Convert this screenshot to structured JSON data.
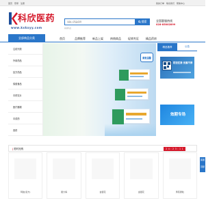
{
  "topbar": {
    "links": [
      "首页",
      "登录",
      "注册"
    ],
    "right_links": [
      "我的订单",
      "联系我们",
      "帮助中心"
    ]
  },
  "logo": {
    "mark": "K",
    "name": "科欣医药",
    "site": "www.kxkxyy.com"
  },
  "search": {
    "placeholder": "请输入药品名称",
    "button": "搜索",
    "hot": "热搜药品"
  },
  "hotline": {
    "label": "全国客服热线",
    "number": "028-85002899"
  },
  "nav": {
    "category": "全部商品分类",
    "items": [
      "首页",
      "品牌推荐",
      "新品上架",
      "热销商品",
      "促销专区",
      "精品药房"
    ]
  },
  "sidebar": {
    "items": [
      "注射剂类",
      "外用药品",
      "处方药品",
      "保健食品",
      "中药饮片",
      "医疗器械",
      "中成药",
      "西药"
    ]
  },
  "banner": {
    "badge": "康复温馨"
  },
  "right_panel": {
    "tab_active": "精品推荐",
    "tab_inactive": "公告",
    "ad1_text": "防控在我 优惠不停",
    "ad2_text": "效期专场"
  },
  "section": {
    "title": "限时抢购",
    "title_prefix": "|",
    "timer": "2 4 : 2 3 : 1 1"
  },
  "products": [
    {
      "name": "阿胶(复方)"
    },
    {
      "name": "胆大梅"
    },
    {
      "name": "金银花"
    },
    {
      "name": "金银花"
    },
    {
      "name": "黄芪颗粒"
    }
  ],
  "float_bar": {
    "items": [
      "客服",
      "顶部"
    ]
  },
  "colors": {
    "primary": "#2a76c9",
    "brand_red": "#d5182a"
  }
}
